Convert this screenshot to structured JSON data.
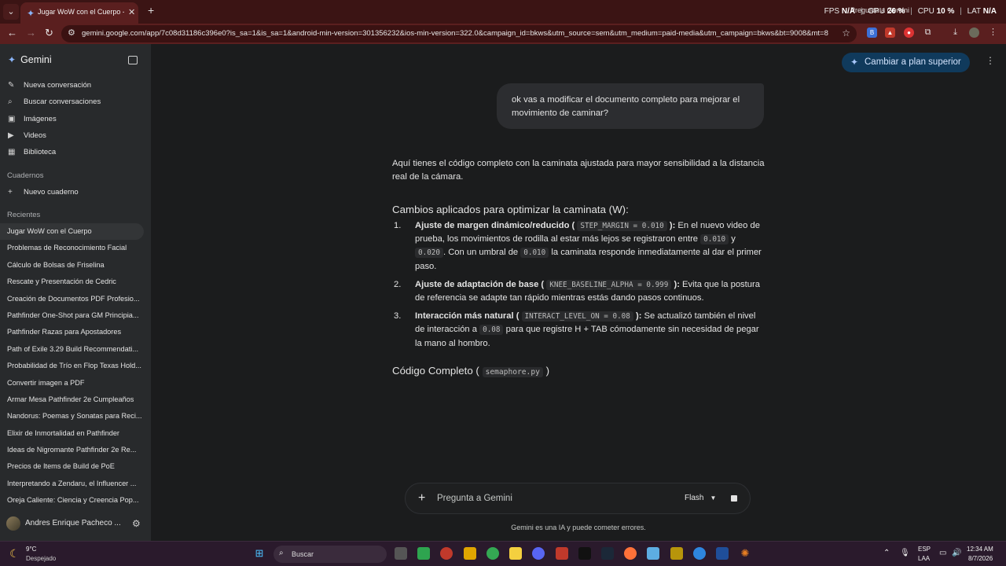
{
  "browser": {
    "tab_title": "Jugar WoW con el Cuerpo - Gemini",
    "url": "gemini.google.com/app/7c08d31186c396e0?is_sa=1&is_sa=1&android-min-version=301356232&ios-min-version=322.0&campaign_id=bkws&utm_source=sem&utm_medium=paid-media&utm_campaign=bkws&bt=9008&mt=8...",
    "overlay_text": "Pregunta a Gemini",
    "perf": {
      "fps_label": "FPS",
      "fps_value": "N/A",
      "gpu_label": "GPU",
      "gpu_value": "26 %",
      "cpu_label": "CPU",
      "cpu_value": "10 %",
      "lat_label": "LAT",
      "lat_value": "N/A"
    }
  },
  "sidebar": {
    "brand": "Gemini",
    "nav": [
      {
        "label": "Nueva conversación",
        "icon": "edit-icon"
      },
      {
        "label": "Buscar conversaciones",
        "icon": "search-icon"
      },
      {
        "label": "Imágenes",
        "icon": "image-icon"
      },
      {
        "label": "Videos",
        "icon": "video-icon"
      },
      {
        "label": "Biblioteca",
        "icon": "library-icon"
      }
    ],
    "notebooks_label": "Cuadernos",
    "new_notebook": "Nuevo cuaderno",
    "recents_label": "Recientes",
    "recents": [
      "Jugar WoW con el Cuerpo",
      "Problemas de Reconocimiento Facial",
      "Cálculo de Bolsas de Friselina",
      "Rescate y Presentación de Cedric",
      "Creación de Documentos PDF Profesio...",
      "Pathfinder One-Shot para GM Principia...",
      "Pathfinder Razas para Apostadores",
      "Path of Exile 3.29 Build Recommendati...",
      "Probabilidad de Trío en Flop Texas Hold...",
      "Convertir imagen a PDF",
      "Armar Mesa Pathfinder 2e Cumpleaños",
      "Nandorus: Poemas y Sonatas para Reci...",
      "Elixir de Inmortalidad en Pathfinder",
      "Ideas de Nigromante Pathfinder 2e Re...",
      "Precios de Items de Build de PoE",
      "Interpretando a Zendaru, el Influencer ...",
      "Oreja Caliente: Ciencia y Creencia Pop..."
    ],
    "user_name": "Andres Enrique Pacheco ..."
  },
  "main": {
    "upgrade_label": "Cambiar a plan superior",
    "user_message": "ok vas a modificar el documento completo para mejorar el movimiento de caminar?",
    "intro": "Aquí tienes el código completo con la caminata ajustada para mayor sensibilidad a la distancia real de la cámara.",
    "changes_heading": "Cambios aplicados para optimizar la caminata (W):",
    "changes": [
      {
        "num": "1.",
        "title_a": "Ajuste de margen dinámico/reducido (",
        "code1": "STEP_MARGIN = 0.010",
        "title_b": "):",
        "text1": " En el nuevo video de prueba, los movimientos de rodilla al estar más lejos se registraron entre ",
        "code2": "0.010",
        "text2": " y ",
        "code3": "0.020",
        "text3": ". Con un umbral de ",
        "code4": "0.010",
        "text4": " la caminata responde inmediatamente al dar el primer paso."
      },
      {
        "num": "2.",
        "title_a": "Ajuste de adaptación de base (",
        "code1": "KNEE_BASELINE_ALPHA = 0.999",
        "title_b": "):",
        "text1": " Evita que la postura de referencia se adapte tan rápido mientras estás dando pasos continuos."
      },
      {
        "num": "3.",
        "title_a": "Interacción más natural (",
        "code1": "INTERACT_LEVEL_ON = 0.08",
        "title_b": "):",
        "text1": " Se actualizó también el nivel de interacción a ",
        "code2": "0.08",
        "text2": " para que registre H + TAB cómodamente sin necesidad de pegar la mano al hombro."
      }
    ],
    "code_heading_a": "Código Completo (",
    "code_heading_file": "semaphore.py",
    "code_heading_b": ")",
    "composer_placeholder": "Pregunta a Gemini",
    "model_label": "Flash",
    "disclaimer": "Gemini es una IA y puede cometer errores."
  },
  "taskbar": {
    "temp": "9°C",
    "weather": "Despejado",
    "search_label": "Buscar",
    "lang_top": "ESP",
    "lang_bottom": "LAA",
    "time": "12:34 AM",
    "date": "8/7/2026"
  }
}
